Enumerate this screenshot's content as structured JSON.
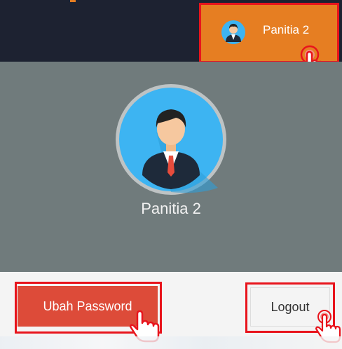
{
  "navbar": {
    "user_menu_label": "Panitia 2"
  },
  "dropdown": {
    "header_name": "Panitia 2",
    "change_password_label": "Ubah Password",
    "logout_label": "Logout"
  },
  "colors": {
    "navbar_bg": "#1d2231",
    "user_button_bg": "#e67e22",
    "header_bg": "#707b7c",
    "danger_button_bg": "#dd4b39",
    "highlight_border": "#e8141c",
    "avatar_circle": "#3db4f2"
  },
  "icons": {
    "avatar": "user-avatar-icon",
    "pointer": "hand-pointer-icon"
  }
}
